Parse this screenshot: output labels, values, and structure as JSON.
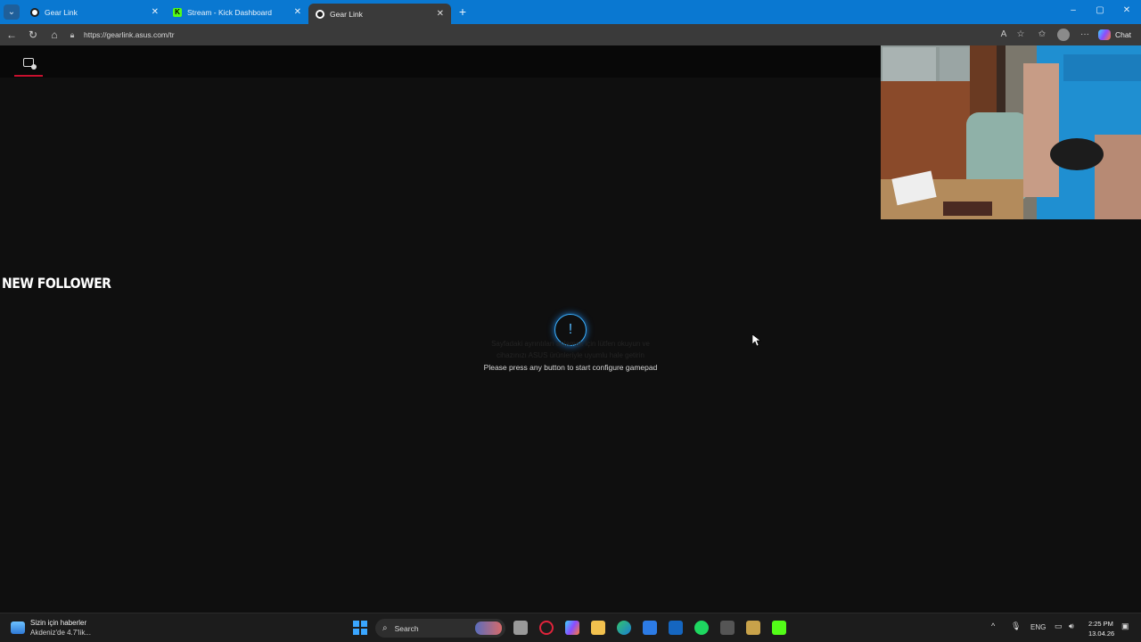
{
  "browser": {
    "tabs": [
      {
        "label": "Gear Link",
        "favicon": "gear-link-icon",
        "active": false
      },
      {
        "label": "Stream - Kick Dashboard",
        "favicon": "kick-icon",
        "active": false
      },
      {
        "label": "Gear Link",
        "favicon": "gear-link-icon",
        "active": true
      }
    ],
    "tab_menu_icon": "chevron-down-icon",
    "new_tab_icon": "plus-icon",
    "url": "https://gearlink.asus.com/tr",
    "chat_label": "Chat",
    "accent_color": "#0a78d1"
  },
  "page": {
    "header_icon": "device-settings-icon",
    "header_accent": "#c8102e",
    "overlay_label": "NEW FOLLOWER",
    "alert_symbol": "!",
    "ghost_line_1": "Sayfadaki ayrıntıları anlamak için lütfen okuyun ve",
    "ghost_line_2": "cihazınızı ASUS ürünleriyle uyumlu hale getirin",
    "message": "Please press any button to start configure gamepad"
  },
  "taskbar": {
    "news_title": "Sizin için haberler",
    "news_subtitle": "Akdeniz'de 4.7'lik...",
    "search_label": "Search",
    "language": "ENG",
    "time": "2:25 PM",
    "date": "13.04.26"
  }
}
